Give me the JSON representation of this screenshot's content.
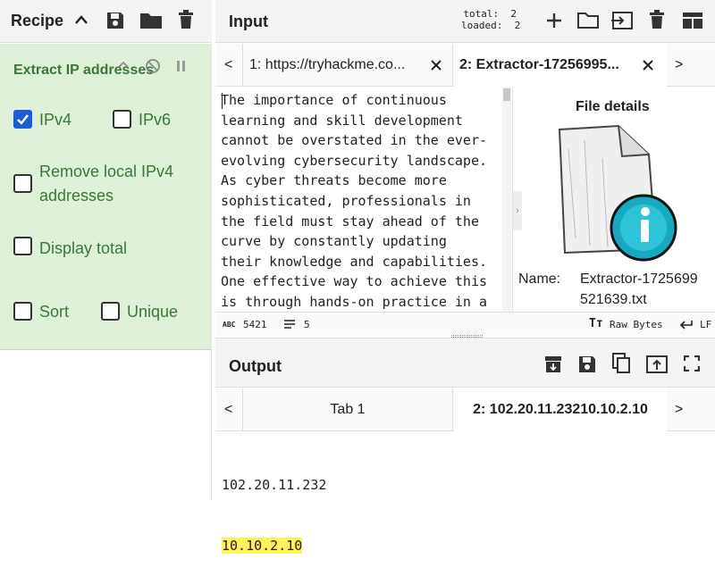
{
  "recipe": {
    "title": "Recipe"
  },
  "operation": {
    "name": "Extract IP addresses",
    "options": [
      {
        "label": "IPv4",
        "checked": true
      },
      {
        "label": "IPv6",
        "checked": false
      },
      {
        "label": "Remove local IPv4",
        "label2": "addresses",
        "checked": false
      },
      {
        "label": "Display total",
        "checked": false
      },
      {
        "label": "Sort",
        "checked": false
      },
      {
        "label": "Unique",
        "checked": false
      }
    ]
  },
  "input": {
    "title": "Input",
    "total_label": "total:",
    "total": "2",
    "loaded_label": "loaded:",
    "loaded": "2",
    "tabs": [
      "1: https://tryhackme.co...",
      "2: Extractor-17256995..."
    ],
    "text": "The importance of continuous\nlearning and skill development\ncannot be overstated in the ever-\nevolving cybersecurity landscape.\nAs cyber threats become more\nsophisticated, professionals in\nthe field must stay ahead of the\ncurve by constantly updating\ntheir knowledge and capabilities.\nOne effective way to achieve this\nis through hands-on practice in a",
    "char_count": "5421",
    "line_count": "5",
    "raw_bytes": "Raw Bytes",
    "eol": "LF"
  },
  "file_details": {
    "title": "File details",
    "name_label": "Name:",
    "name_line1": "Extractor-1725699",
    "name_line2": "521639.txt"
  },
  "output": {
    "title": "Output",
    "tabs": [
      "Tab 1",
      "2: 102.20.11.23210.10.2.10"
    ],
    "line1": "102.20.11.232",
    "line2": "10.10.2.10"
  },
  "nav": {
    "prev": "<",
    "next": ">"
  },
  "colors": {
    "accent": "#1e5bd6",
    "green": "#3c763d",
    "highlight": "#fff15a"
  }
}
